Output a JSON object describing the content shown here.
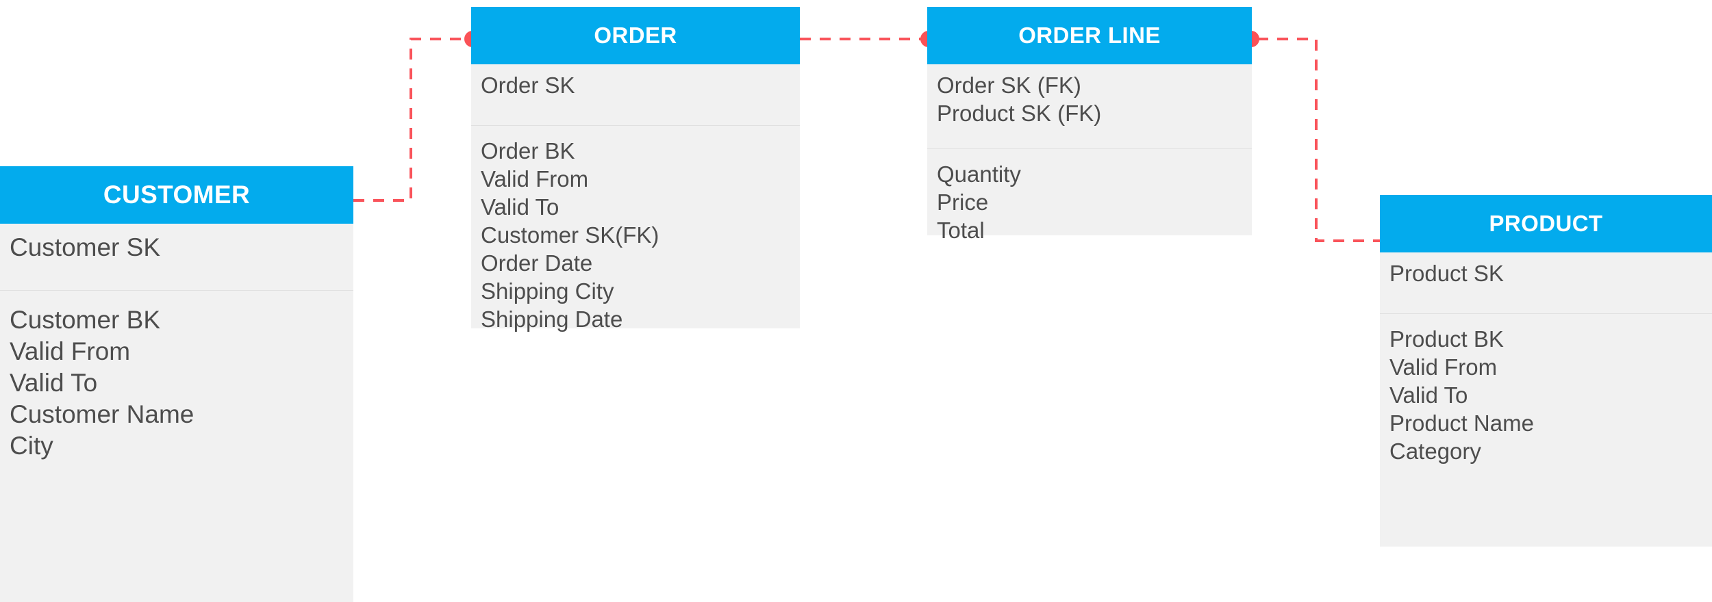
{
  "diagram": {
    "title": "Data Vault / Dimensional ER Diagram",
    "colors": {
      "entity_header": "#03abed",
      "entity_body": "#f1f1f1",
      "relationship": "#f9535a",
      "attribute_text": "#4d4d4d",
      "header_text": "#ffffff",
      "background": "#ffffff"
    }
  },
  "entities": [
    {
      "id": "customer",
      "name": "CUSTOMER",
      "keys": [
        "Customer SK"
      ],
      "attributes": [
        "Customer BK",
        "Valid From",
        "Valid To",
        "Customer Name",
        "City"
      ]
    },
    {
      "id": "order",
      "name": "ORDER",
      "keys": [
        "Order SK"
      ],
      "attributes": [
        "Order BK",
        "Valid From",
        "Valid To",
        "Customer SK(FK)",
        "Order Date",
        "Shipping City",
        "Shipping Date"
      ]
    },
    {
      "id": "orderline",
      "name": "ORDER LINE",
      "keys": [
        "Order SK (FK)",
        "Product SK (FK)"
      ],
      "attributes": [
        "Quantity",
        "Price",
        "Total"
      ]
    },
    {
      "id": "product",
      "name": "PRODUCT",
      "keys": [
        "Product SK"
      ],
      "attributes": [
        "Product BK",
        "Valid From",
        "Valid To",
        "Product Name",
        "Category"
      ]
    }
  ],
  "relationships": [
    {
      "id": "customer-order",
      "from": "CUSTOMER",
      "to": "ORDER",
      "style": "dashed"
    },
    {
      "id": "order-orderline",
      "from": "ORDER",
      "to": "ORDER LINE",
      "style": "dashed"
    },
    {
      "id": "orderline-product",
      "from": "ORDER LINE",
      "to": "PRODUCT",
      "style": "dashed"
    }
  ]
}
